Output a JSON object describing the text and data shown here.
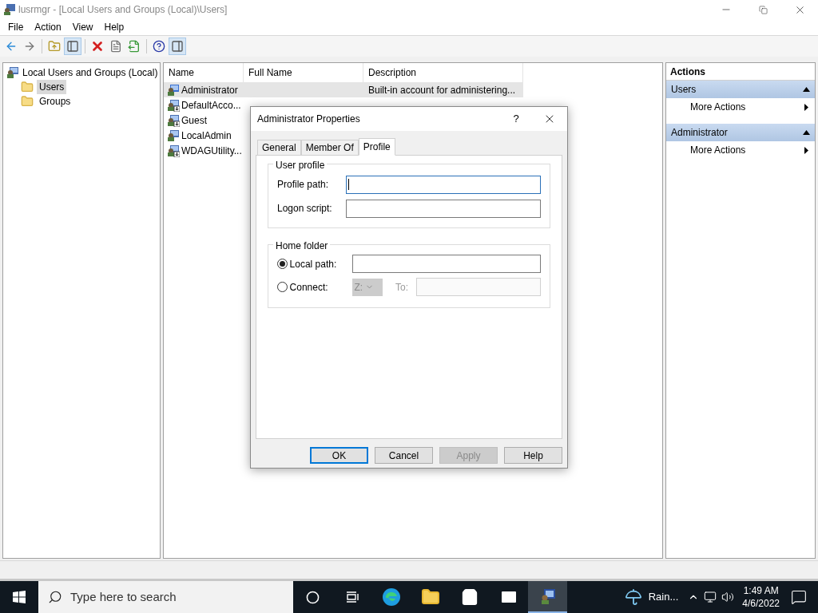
{
  "window": {
    "title": "lusrmgr - [Local Users and Groups (Local)\\Users]"
  },
  "menu": [
    "File",
    "Action",
    "View",
    "Help"
  ],
  "toolbar": [
    {
      "kind": "back",
      "pressed": false
    },
    {
      "kind": "forward",
      "pressed": false
    },
    {
      "kind": "up",
      "pressed": false
    },
    {
      "kind": "tree",
      "pressed": true
    },
    {
      "kind": "delete",
      "pressed": false
    },
    {
      "kind": "properties",
      "pressed": false
    },
    {
      "kind": "export",
      "pressed": false
    },
    {
      "kind": "help",
      "pressed": false
    },
    {
      "kind": "actionpane",
      "pressed": true
    }
  ],
  "tree": {
    "label": "Local Users and Groups (Local)",
    "children": [
      {
        "label": "Users",
        "selected": true
      },
      {
        "label": "Groups",
        "selected": false
      }
    ]
  },
  "list": {
    "columns": [
      "Name",
      "Full Name",
      "Description"
    ],
    "rows": [
      {
        "name": "Administrator",
        "description": "Built-in account for administering...",
        "selected": true,
        "disabled": false
      },
      {
        "name": "DefaultAcco...",
        "selected": false,
        "disabled": true
      },
      {
        "name": "Guest",
        "selected": false,
        "disabled": true
      },
      {
        "name": "LocalAdmin",
        "selected": false,
        "disabled": false
      },
      {
        "name": "WDAGUtility...",
        "selected": false,
        "disabled": true
      }
    ]
  },
  "actions": {
    "title": "Actions",
    "sections": [
      {
        "title": "Users",
        "expanded": true,
        "items": [
          "More Actions"
        ]
      },
      {
        "title": "Administrator",
        "expanded": true,
        "items": [
          "More Actions"
        ]
      }
    ]
  },
  "dialog": {
    "title": "Administrator Properties",
    "help": "?",
    "tabs": [
      {
        "label": "General",
        "selected": false
      },
      {
        "label": "Member Of",
        "selected": false
      },
      {
        "label": "Profile",
        "selected": true
      }
    ],
    "user_profile": {
      "title": "User profile",
      "fields": [
        {
          "label": "Profile path:",
          "focused": true
        },
        {
          "label": "Logon script:",
          "focused": false
        }
      ]
    },
    "home_folder": {
      "title": "Home folder",
      "options": [
        {
          "label": "Local path:",
          "selected": true
        },
        {
          "label": "Connect:",
          "selected": false
        }
      ],
      "drive": "Z:",
      "to_label": "To:"
    },
    "buttons": [
      {
        "label": "OK",
        "default": true,
        "disabled": false
      },
      {
        "label": "Cancel",
        "default": false,
        "disabled": false
      },
      {
        "label": "Apply",
        "default": false,
        "disabled": true
      },
      {
        "label": "Help",
        "default": false,
        "disabled": false
      }
    ]
  },
  "taskbar": {
    "search_placeholder": "Type here to search",
    "apps": [
      {
        "kind": "cortana",
        "selected": false
      },
      {
        "kind": "taskview",
        "selected": false
      },
      {
        "kind": "edge",
        "selected": false
      },
      {
        "kind": "explorer",
        "selected": false
      },
      {
        "kind": "store",
        "selected": false
      },
      {
        "kind": "mail",
        "selected": false
      },
      {
        "kind": "lusrmgr",
        "selected": true
      }
    ],
    "weather": "Rain...",
    "time": "1:49 AM",
    "date": "4/6/2022"
  }
}
